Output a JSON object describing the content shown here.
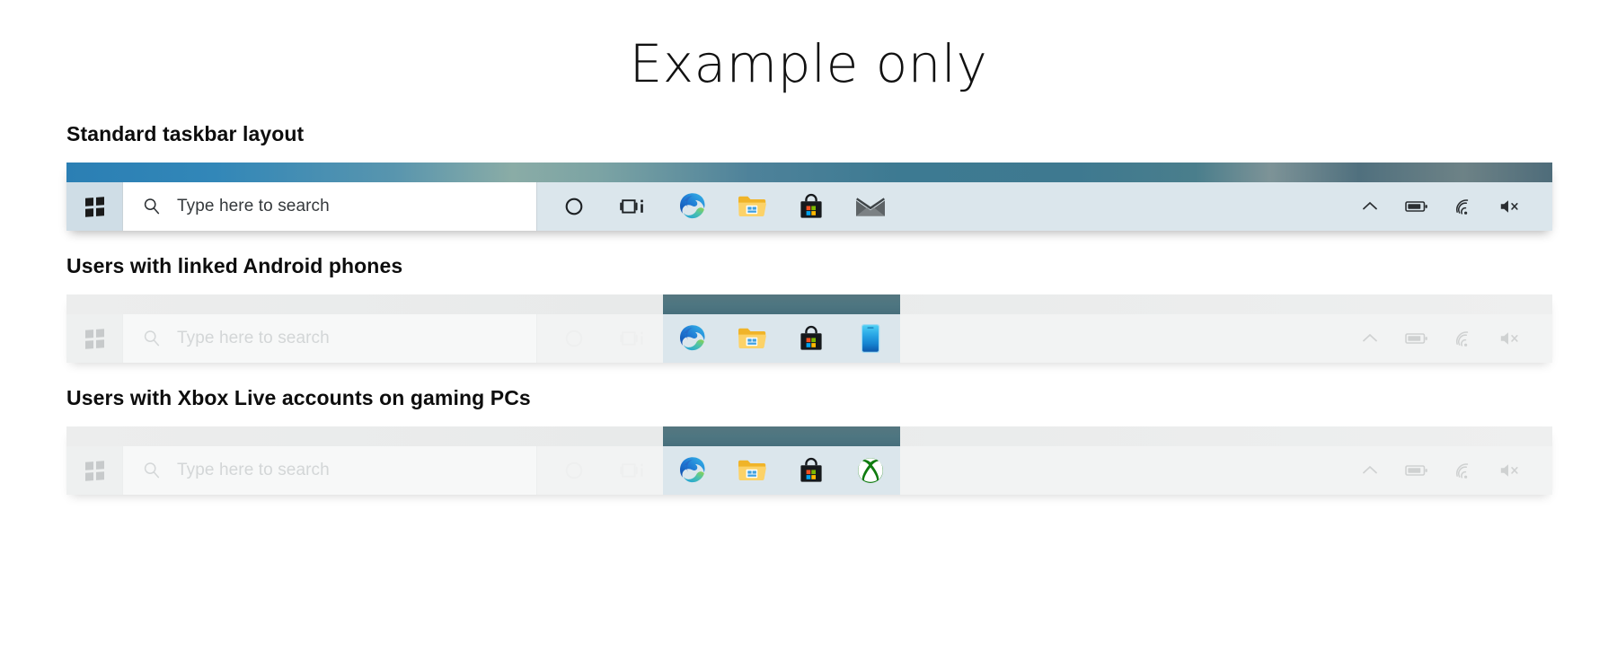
{
  "page": {
    "title": "Example only",
    "background_color": "#ffffff"
  },
  "colors": {
    "taskbar": "#dbe6ec",
    "taskbar_faded": "#f2f3f3",
    "start_button": "#cfdde6",
    "search_box": "#ffffff",
    "highlight_wallpaper": "#4e7681",
    "heading_text": "#0d0d0d",
    "edge_blue": "#2b6cc4",
    "edge_green": "#5ec18e",
    "folder_yellow": "#f5bc44",
    "store_black": "#16191c",
    "xbox_green": "#107c10",
    "phone_blue": "#29a8e0"
  },
  "sections": [
    {
      "heading": "Standard taskbar layout",
      "faded": false,
      "highlight": false,
      "start_label": "Start",
      "search": {
        "placeholder": "Type here to search",
        "value": "",
        "icon": "search-icon"
      },
      "icons": [
        {
          "name": "cortana-icon",
          "label": "Cortana",
          "highlighted": false
        },
        {
          "name": "task-view-icon",
          "label": "Task View",
          "highlighted": false
        },
        {
          "name": "edge-icon",
          "label": "Microsoft Edge",
          "highlighted": false
        },
        {
          "name": "file-explorer-icon",
          "label": "File Explorer",
          "highlighted": false
        },
        {
          "name": "microsoft-store-icon",
          "label": "Microsoft Store",
          "highlighted": false
        },
        {
          "name": "mail-icon",
          "label": "Mail",
          "highlighted": false
        }
      ],
      "tray": [
        {
          "name": "chevron-up-icon",
          "label": "Show hidden icons"
        },
        {
          "name": "battery-icon",
          "label": "Battery"
        },
        {
          "name": "wifi-icon",
          "label": "Network"
        },
        {
          "name": "speaker-muted-icon",
          "label": "Volume muted"
        }
      ]
    },
    {
      "heading": "Users with linked Android phones",
      "faded": true,
      "highlight": true,
      "start_label": "Start",
      "search": {
        "placeholder": "Type here to search",
        "value": "",
        "icon": "search-icon"
      },
      "icons": [
        {
          "name": "cortana-icon",
          "label": "Cortana",
          "highlighted": false
        },
        {
          "name": "task-view-icon",
          "label": "Task View",
          "highlighted": false
        },
        {
          "name": "edge-icon",
          "label": "Microsoft Edge",
          "highlighted": true
        },
        {
          "name": "file-explorer-icon",
          "label": "File Explorer",
          "highlighted": true
        },
        {
          "name": "microsoft-store-icon",
          "label": "Microsoft Store",
          "highlighted": true
        },
        {
          "name": "your-phone-icon",
          "label": "Your Phone",
          "highlighted": true
        }
      ],
      "tray": [
        {
          "name": "chevron-up-icon",
          "label": "Show hidden icons"
        },
        {
          "name": "battery-icon",
          "label": "Battery"
        },
        {
          "name": "wifi-icon",
          "label": "Network"
        },
        {
          "name": "speaker-muted-icon",
          "label": "Volume muted"
        }
      ]
    },
    {
      "heading": "Users with Xbox Live accounts on gaming PCs",
      "faded": true,
      "highlight": true,
      "start_label": "Start",
      "search": {
        "placeholder": "Type here to search",
        "value": "",
        "icon": "search-icon"
      },
      "icons": [
        {
          "name": "cortana-icon",
          "label": "Cortana",
          "highlighted": false
        },
        {
          "name": "task-view-icon",
          "label": "Task View",
          "highlighted": false
        },
        {
          "name": "edge-icon",
          "label": "Microsoft Edge",
          "highlighted": true
        },
        {
          "name": "file-explorer-icon",
          "label": "File Explorer",
          "highlighted": true
        },
        {
          "name": "microsoft-store-icon",
          "label": "Microsoft Store",
          "highlighted": true
        },
        {
          "name": "xbox-icon",
          "label": "Xbox",
          "highlighted": true
        }
      ],
      "tray": [
        {
          "name": "chevron-up-icon",
          "label": "Show hidden icons"
        },
        {
          "name": "battery-icon",
          "label": "Battery"
        },
        {
          "name": "wifi-icon",
          "label": "Network"
        },
        {
          "name": "speaker-muted-icon",
          "label": "Volume muted"
        }
      ]
    }
  ]
}
